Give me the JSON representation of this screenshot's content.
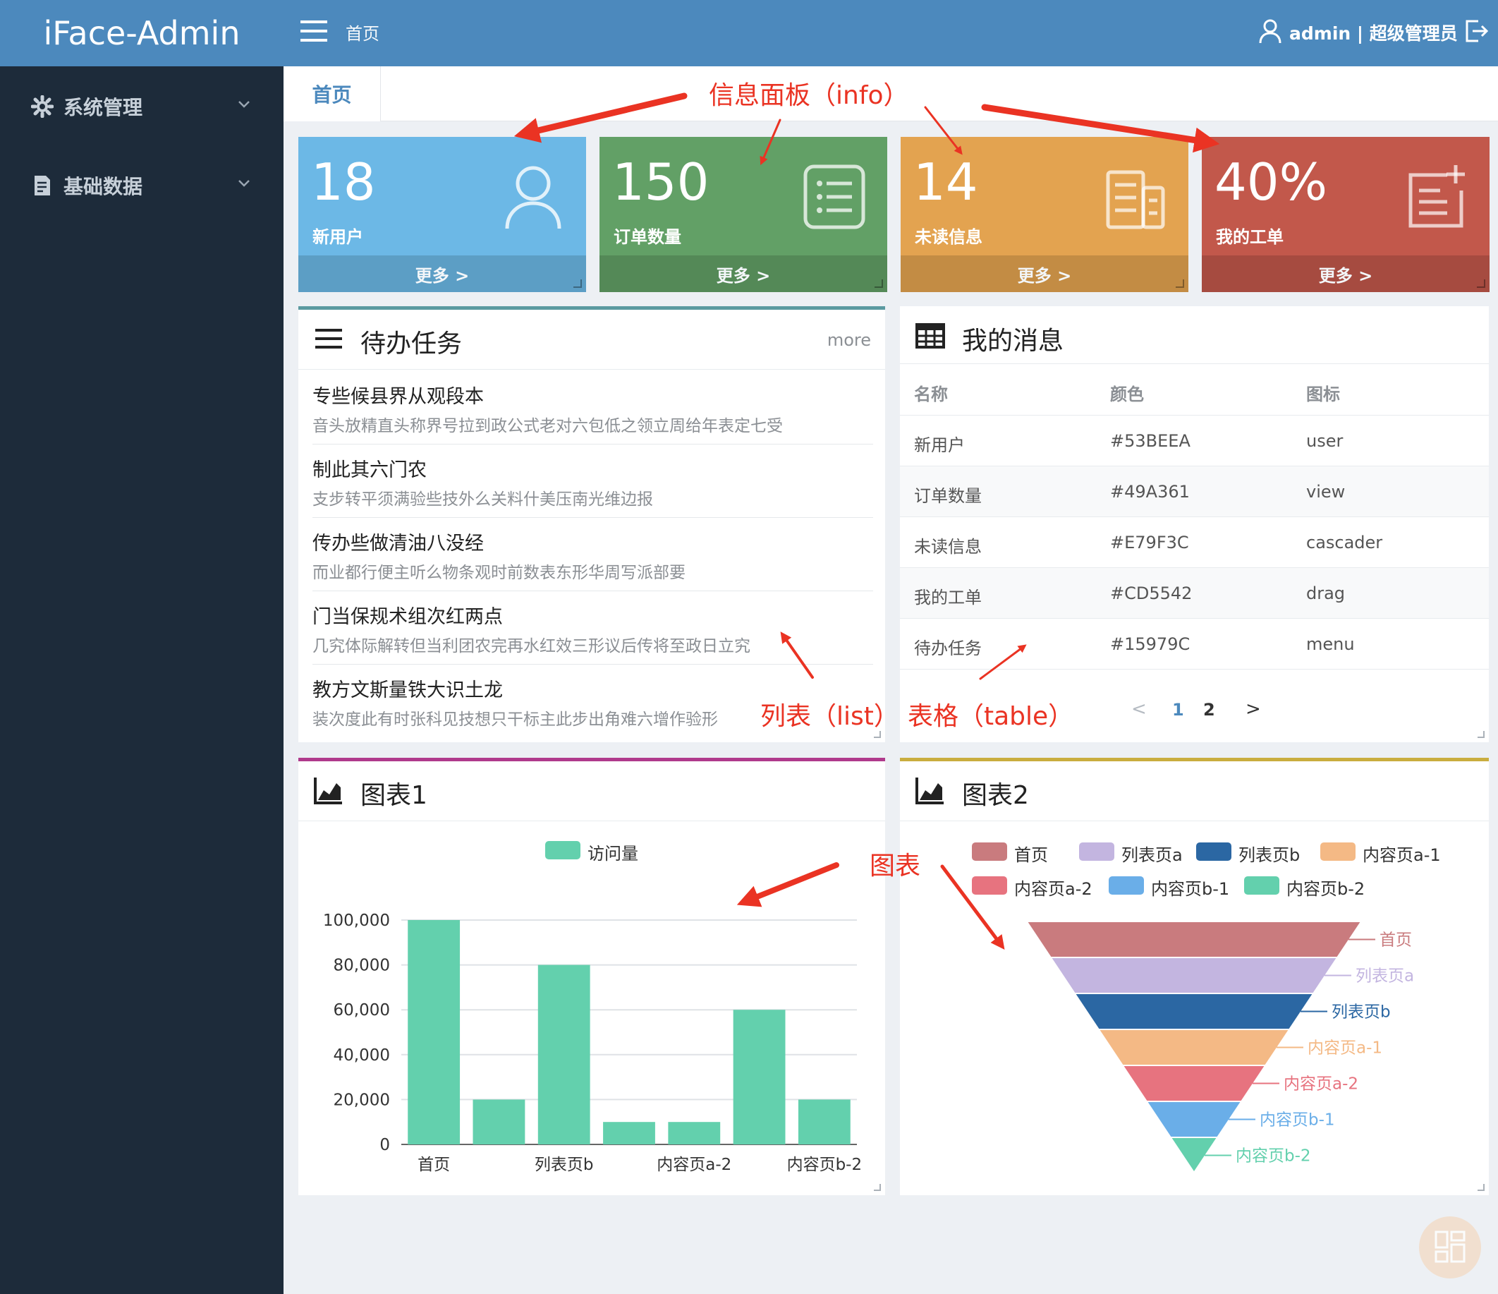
{
  "app": {
    "title": "iFace-Admin"
  },
  "sidebar": {
    "items": [
      {
        "label": "系统管理",
        "icon": "gear-icon"
      },
      {
        "label": "基础数据",
        "icon": "document-icon"
      }
    ]
  },
  "header": {
    "breadcrumb": "首页",
    "user": "admin | 超级管理员"
  },
  "tabs": [
    {
      "label": "首页"
    }
  ],
  "cards": [
    {
      "value": "18",
      "label": "新用户",
      "more": "更多 >",
      "color": "#6cb8e6",
      "icon": "user-icon"
    },
    {
      "value": "150",
      "label": "订单数量",
      "more": "更多 >",
      "color": "#62a066",
      "icon": "list-icon"
    },
    {
      "value": "14",
      "label": "未读信息",
      "more": "更多 >",
      "color": "#e3a350",
      "icon": "building-icon"
    },
    {
      "value": "40%",
      "label": "我的工单",
      "more": "更多 >",
      "color": "#c2584b",
      "icon": "edit-icon"
    }
  ],
  "todo": {
    "title": "待办任务",
    "more": "more",
    "items": [
      {
        "title": "专些候县界从观段本",
        "desc": "音头放精直头称界号拉到政公式老对六包低之领立周给年表定七受"
      },
      {
        "title": "制此其六门农",
        "desc": "支步转平须满验些技外么关料什美压南光维边报"
      },
      {
        "title": "传办些做清油八没经",
        "desc": "而业都行便主听么物条观时前数表东形华周写派部要"
      },
      {
        "title": "门当保规术组次红两点",
        "desc": "几究体际解转但当利团农完再水红效三形议后传将至政日立究"
      },
      {
        "title": "教方文斯量铁大识土龙",
        "desc": "装次度此有时张科见技想只干标主此步出角难六增作验形"
      }
    ]
  },
  "messages": {
    "title": "我的消息",
    "columns": [
      "名称",
      "颜色",
      "图标"
    ],
    "rows": [
      [
        "新用户",
        "#53BEEA",
        "user"
      ],
      [
        "订单数量",
        "#49A361",
        "view"
      ],
      [
        "未读信息",
        "#E79F3C",
        "cascader"
      ],
      [
        "我的工单",
        "#CD5542",
        "drag"
      ],
      [
        "待办任务",
        "#15979C",
        "menu"
      ]
    ],
    "pagination": {
      "prev": "<",
      "pages": [
        "1",
        "2"
      ],
      "current": "1",
      "next": ">"
    }
  },
  "chart1": {
    "title": "图表1"
  },
  "chart2": {
    "title": "图表2"
  },
  "annotations": {
    "info": "信息面板（info）",
    "list": "列表（list）",
    "table": "表格（table）",
    "chart": "图表"
  },
  "chart_data": [
    {
      "type": "bar",
      "title": "",
      "series": [
        {
          "name": "访问量",
          "color": "#63d0ad",
          "values": [
            100000,
            20000,
            80000,
            10000,
            10000,
            60000,
            20000
          ]
        }
      ],
      "categories": [
        "首页",
        "列表页a",
        "列表页b",
        "内容页a-1",
        "内容页a-2",
        "内容页b-1",
        "内容页b-2"
      ],
      "tick_labels_shown": [
        "首页",
        "列表页b",
        "内容页a-2",
        "内容页b-2"
      ],
      "y_ticks": [
        "100,000",
        "80,000",
        "60,000",
        "40,000",
        "20,000",
        "0"
      ],
      "ylim": [
        0,
        100000
      ],
      "grid": true,
      "legend": "top-center"
    },
    {
      "type": "funnel",
      "title": "",
      "categories": [
        "首页",
        "列表页a",
        "列表页b",
        "内容页a-1",
        "内容页a-2",
        "内容页b-1",
        "内容页b-2"
      ],
      "colors": [
        "#c97b7e",
        "#c3b5e0",
        "#2b67a3",
        "#f4b985",
        "#e7737f",
        "#6aaee8",
        "#63d0ad"
      ],
      "legend": "top-center"
    }
  ]
}
